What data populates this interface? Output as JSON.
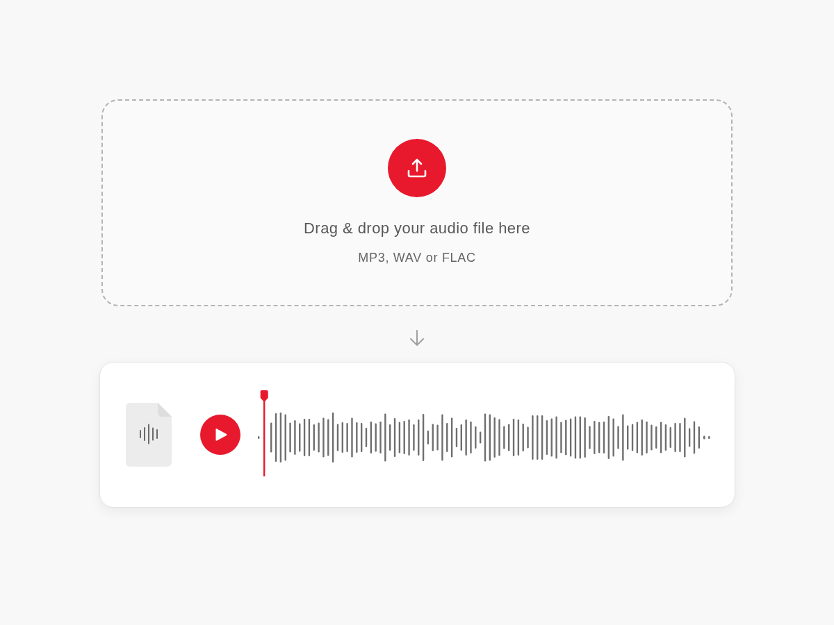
{
  "dropzone": {
    "title": "Drag & drop your audio file here",
    "formats": "MP3, WAV or FLAC"
  },
  "player": {
    "playhead": {
      "level": 0.02
    }
  }
}
